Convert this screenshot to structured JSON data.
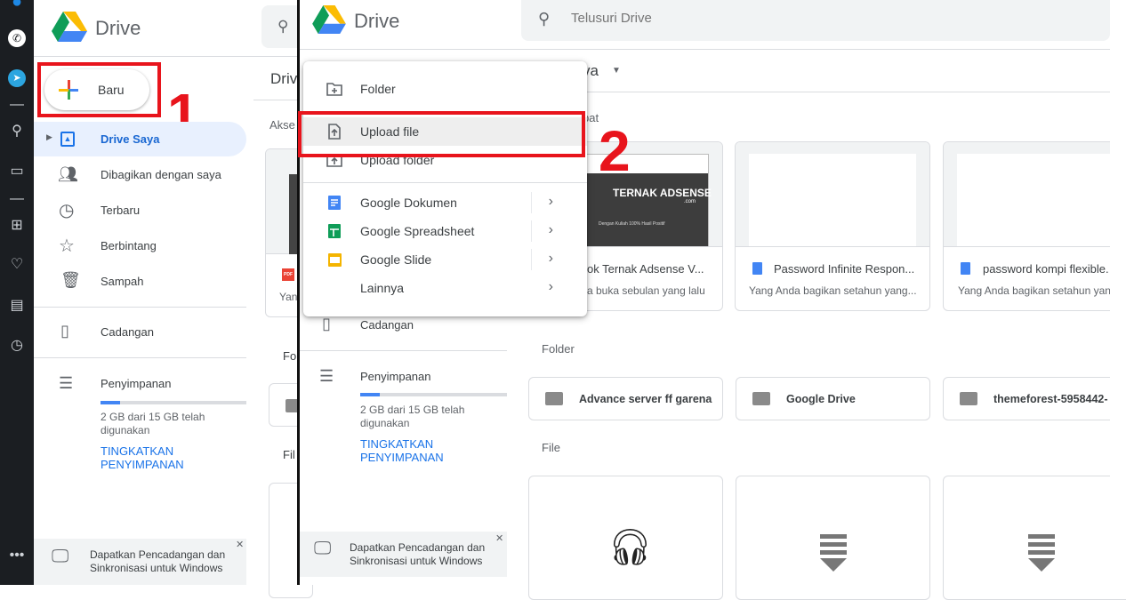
{
  "left_panel": {
    "app_name": "Drive",
    "new_button": "Baru",
    "step_label": "1",
    "nav": [
      {
        "label": "Drive Saya",
        "icon": "my-drive-icon",
        "active": true
      },
      {
        "label": "Dibagikan dengan saya",
        "icon": "people-icon"
      },
      {
        "label": "Terbaru",
        "icon": "clock-icon"
      },
      {
        "label": "Berbintang",
        "icon": "star-icon"
      },
      {
        "label": "Sampah",
        "icon": "trash-icon"
      }
    ],
    "backup": "Cadangan",
    "storage": {
      "label": "Penyimpanan",
      "used_fraction": 0.133,
      "text": "2 GB dari 15 GB telah digunakan",
      "upgrade": "TINGKATKAN PENYIMPANAN"
    },
    "promo": "Dapatkan Pencadangan dan Sinkronisasi untuk Windows",
    "peek": {
      "title": "Driv",
      "quick": "Akse",
      "card_sub": "Yan",
      "folders": "Fol",
      "files": "Fil"
    }
  },
  "right_panel": {
    "app_name": "Drive",
    "search_placeholder": "Telusuri Drive",
    "title_visible": "ya",
    "quick_access_visible": "pat",
    "step_label": "2",
    "backup": "Cadangan",
    "storage": {
      "label": "Penyimpanan",
      "used_fraction": 0.133,
      "text": "2 GB dari 15 GB telah digunakan",
      "upgrade": "TINGKATKAN PENYIMPANAN"
    },
    "promo": "Dapatkan Pencadangan dan Sinkronisasi untuk Windows",
    "quick_cards": [
      {
        "name": "ok Ternak Adsense V...",
        "sub": "a buka sebulan yang lalu",
        "thumb_text": "TERNAK ADSENSE",
        "thumb_sub": ".com",
        "thumb_tagline": "Dengan Kuliah 100% Hasil Positif"
      },
      {
        "name": "Password Infinite Respon...",
        "sub": "Yang Anda bagikan setahun yang..."
      },
      {
        "name": "password kompi flexible.",
        "sub": "Yang Anda bagikan setahun yang"
      }
    ],
    "folders_label": "Folder",
    "folders": [
      "Advance server ff garena",
      "Google Drive",
      "themeforest-5958442-"
    ],
    "files_label": "File",
    "new_menu": [
      {
        "label": "Folder",
        "icon": "new-folder-icon"
      },
      {
        "label": "Upload file",
        "icon": "file-upload-icon",
        "highlighted": true
      },
      {
        "label": "Upload folder",
        "icon": "folder-upload-icon"
      },
      {
        "label": "Google Dokumen",
        "icon": "google-docs-icon",
        "submenu": true
      },
      {
        "label": "Google Spreadsheet",
        "icon": "google-sheets-icon",
        "submenu": true
      },
      {
        "label": "Google Slide",
        "icon": "google-slides-icon",
        "submenu": true
      },
      {
        "label": "Lainnya",
        "submenu": true
      }
    ]
  },
  "colors": {
    "accent": "#1a73e8",
    "annotation": "#e8141c",
    "active_nav_bg": "#e8f0fe",
    "dock": "#1b1e22"
  }
}
